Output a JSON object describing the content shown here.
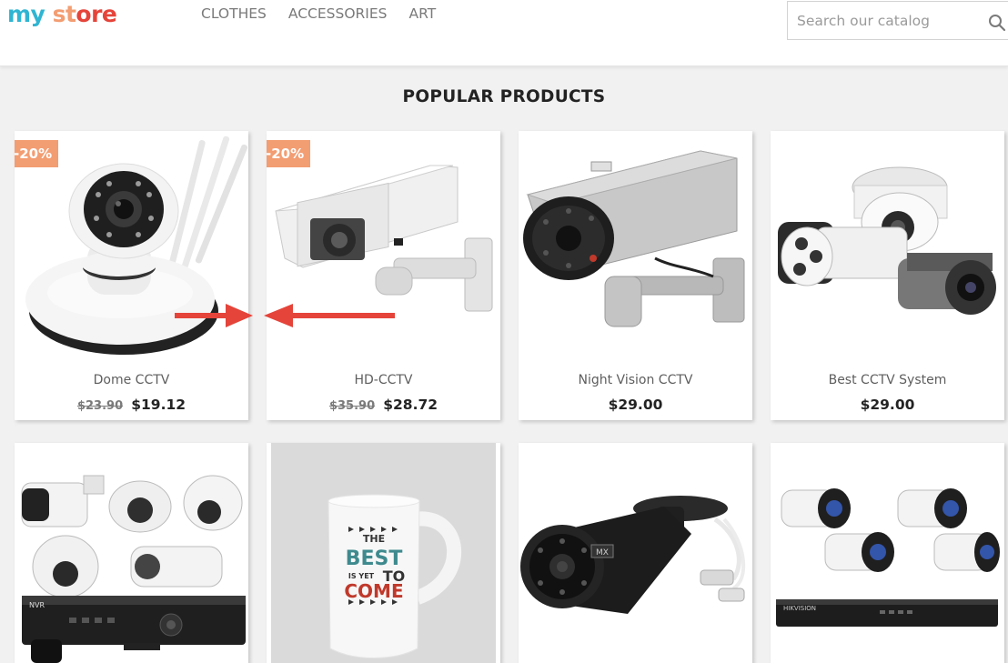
{
  "header": {
    "logo": {
      "part1": "my",
      "part2": " st",
      "part3": "ore"
    },
    "nav": [
      "CLOTHES",
      "ACCESSORIES",
      "ART"
    ],
    "search": {
      "placeholder": "Search our catalog",
      "value": ""
    }
  },
  "section_title": "POPULAR PRODUCTS",
  "products": [
    {
      "name": "Dome CCTV",
      "old_price": "$23.90",
      "price": "$19.12",
      "badge": "-20%"
    },
    {
      "name": "HD-CCTV",
      "old_price": "$35.90",
      "price": "$28.72",
      "badge": "-20%"
    },
    {
      "name": "Night Vision CCTV",
      "old_price": "",
      "price": "$29.00",
      "badge": ""
    },
    {
      "name": "Best CCTV System",
      "old_price": "",
      "price": "$29.00",
      "badge": ""
    },
    {
      "name": "",
      "old_price": "",
      "price": "",
      "badge": ""
    },
    {
      "name": "",
      "old_price": "",
      "price": "",
      "badge": ""
    },
    {
      "name": "",
      "old_price": "",
      "price": "",
      "badge": ""
    },
    {
      "name": "",
      "old_price": "",
      "price": "",
      "badge": ""
    }
  ],
  "mug_text": {
    "line1": "THE",
    "line2": "BEST",
    "line3": "IS YET",
    "line4": "TO",
    "line5": "COME"
  },
  "camera_brand_labels": {
    "mx": "MX",
    "nvr": "NVR",
    "hik": "HIKVISION"
  },
  "colors": {
    "accent": "#2fb5d2",
    "badge": "#f39d72",
    "arrow": "#e5443a"
  }
}
